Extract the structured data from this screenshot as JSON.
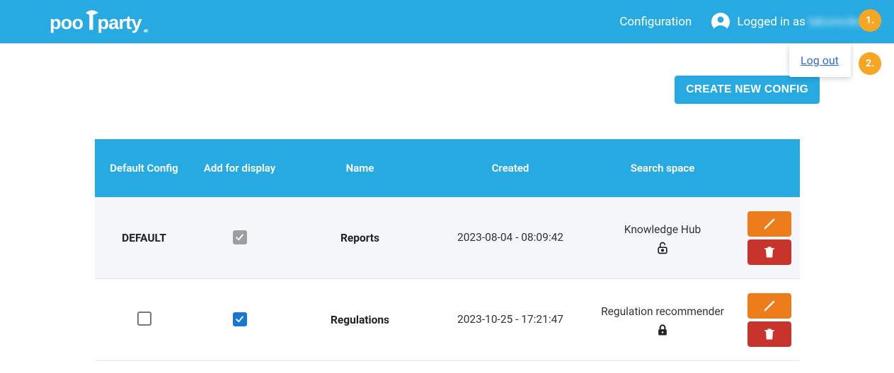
{
  "header": {
    "logo_text": "poolparty",
    "config_link": "Configuration",
    "logged_in_prefix": "Logged in as",
    "username": "lakomcikovar"
  },
  "badges": {
    "b1": "1.",
    "b2": "2."
  },
  "dropdown": {
    "logout": "Log out"
  },
  "buttons": {
    "create": "CREATE NEW CONFIG"
  },
  "table": {
    "headers": {
      "default_config": "Default Config",
      "add_display": "Add for display",
      "name": "Name",
      "created": "Created",
      "search_space": "Search space"
    },
    "rows": [
      {
        "default_label": "DEFAULT",
        "default_checked": false,
        "add_display_checked": true,
        "add_display_disabled": true,
        "name": "Reports",
        "created": "2023-08-04 - 08:09:42",
        "search_space": "Knowledge Hub",
        "locked": false
      },
      {
        "default_label": "",
        "default_checked": false,
        "add_display_checked": true,
        "add_display_disabled": false,
        "name": "Regulations",
        "created": "2023-10-25 - 17:21:47",
        "search_space": "Regulation recommender",
        "locked": true
      }
    ]
  }
}
